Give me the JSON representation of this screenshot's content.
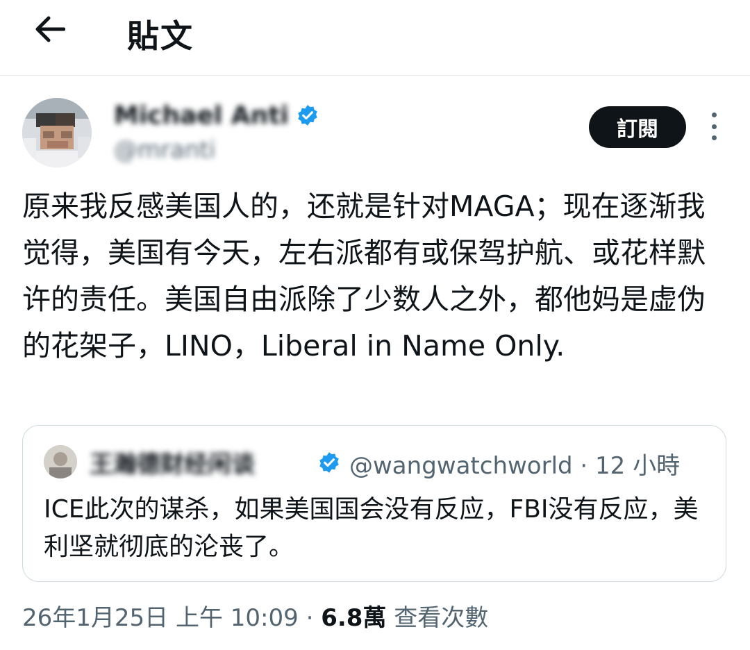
{
  "header": {
    "title": "貼文"
  },
  "author": {
    "name": "Michael Anti",
    "handle": "@mranti",
    "subscribe_label": "訂閱"
  },
  "post": {
    "text": "原来我反感美国人的，还就是针对MAGA；现在逐渐我觉得，美国有今天，左右派都有或保驾护航、或花样默许的责任。美国自由派除了少数人之外，都他妈是虚伪的花架子，LINO，Liberal in Name Only."
  },
  "quote": {
    "name": "王瀚德财经闲谈",
    "handle": "@wangwatchworld",
    "separator": "·",
    "time": "12 小時",
    "text": "ICE此次的谋杀，如果美国国会没有反应，FBI没有反应，美利坚就彻底的沦丧了。"
  },
  "footer": {
    "timestamp": "26年1月25日 上午 10:09",
    "separator": "·",
    "views_count": "6.8萬",
    "views_label": "查看次數"
  },
  "colors": {
    "verified": "#1d9bf0",
    "text": "#0f1419",
    "muted": "#536471"
  },
  "icons": [
    "back-arrow-icon",
    "verified-badge-icon",
    "more-options-icon"
  ]
}
